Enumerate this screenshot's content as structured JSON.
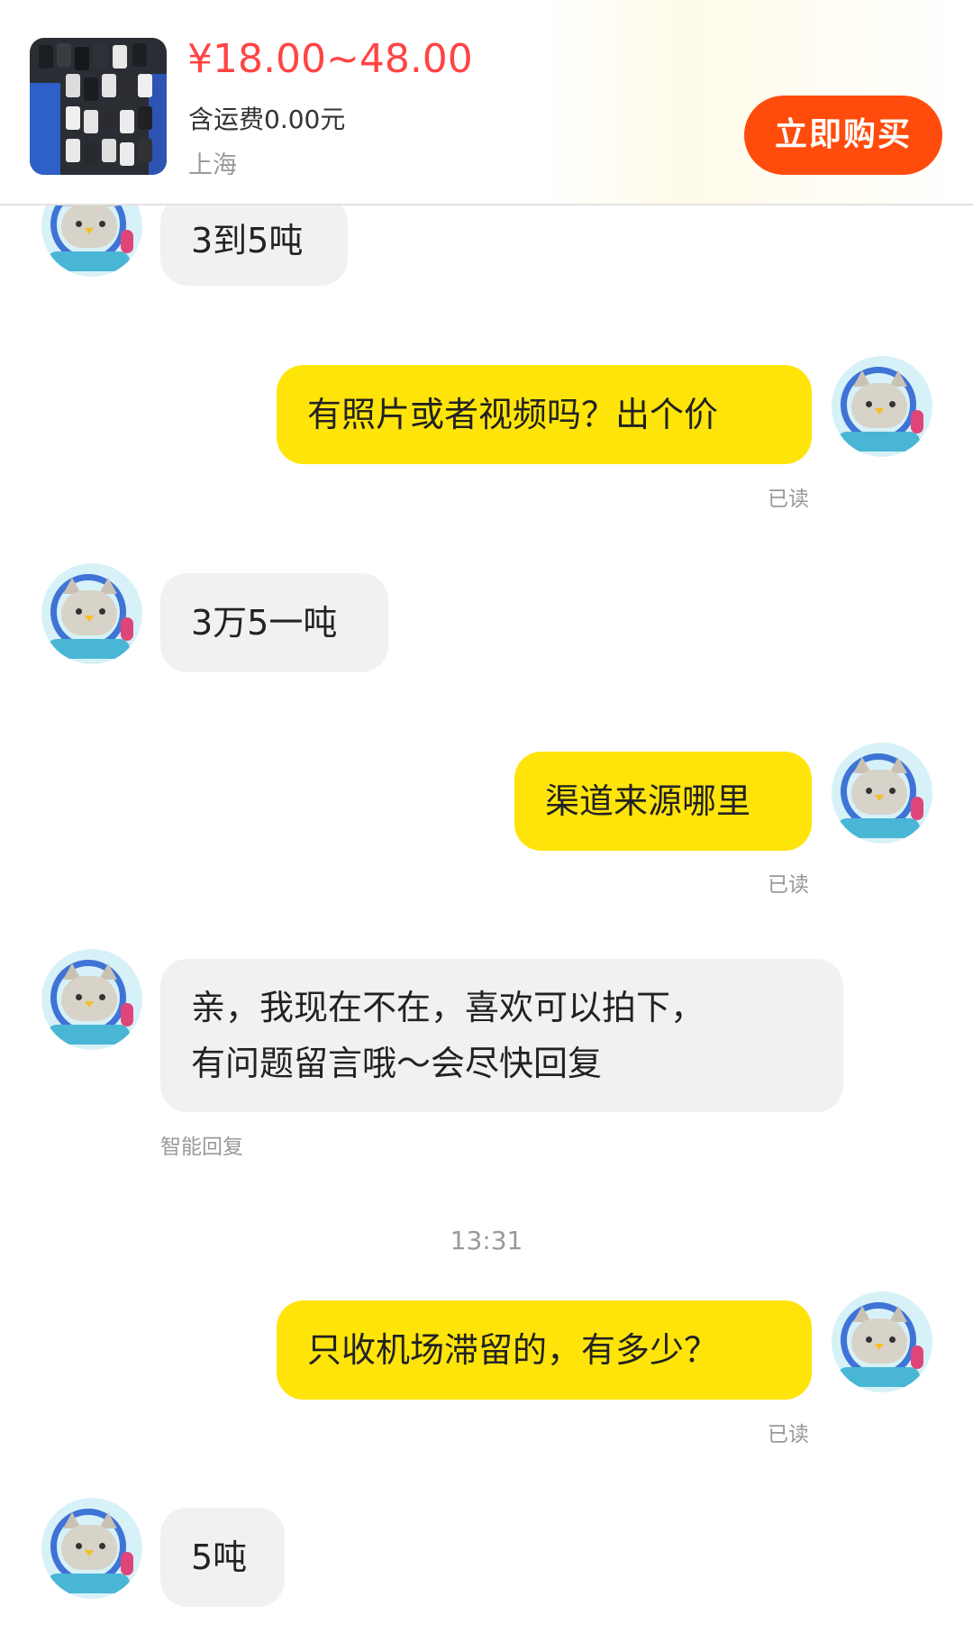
{
  "header": {
    "price": "¥18.00~48.00",
    "shipping": "含运费0.00元",
    "location": "上海",
    "buy_button": "立即购买",
    "thumbnail_icon": "product-photo"
  },
  "chat": {
    "messages": [
      {
        "side": "in",
        "text": "3到5吨"
      },
      {
        "side": "out",
        "text": "有照片或者视频吗？出个价",
        "status": "已读"
      },
      {
        "side": "in",
        "text": "3万5一吨"
      },
      {
        "side": "out",
        "text": "渠道来源哪里",
        "status": "已读"
      },
      {
        "side": "in",
        "text_line1": "亲，我现在不在，喜欢可以拍下，",
        "text_line2": "有问题留言哦～会尽快回复",
        "note": "智能回复"
      },
      {
        "side": "out",
        "text": "只收机场滞留的，有多少？",
        "status": "已读"
      },
      {
        "side": "in",
        "text": "5吨"
      }
    ],
    "timestamp": "13:31"
  },
  "colors": {
    "price": "#ff4444",
    "buy_button": "#ff4c0c",
    "outgoing_bubble": "#ffe40a",
    "incoming_bubble": "#f1f1f3"
  }
}
